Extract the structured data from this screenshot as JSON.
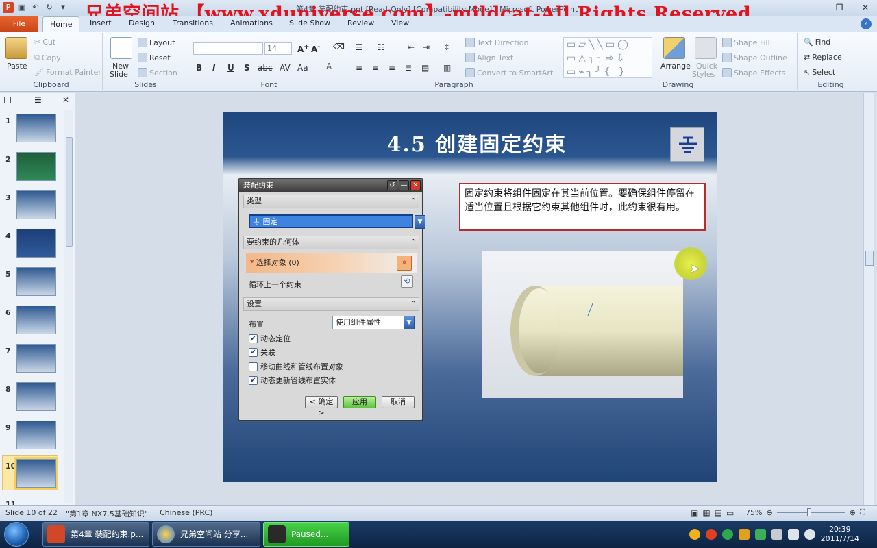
{
  "window": {
    "title": "第4章 装配约束.ppt [Read-Only] [Compatibility Mode] - Microsoft PowerPoint",
    "watermark": "兄弟空间站 【www.xduniverse.com】-mildcat-All Rights Reserved"
  },
  "tabs": {
    "file": "File",
    "items": [
      "Home",
      "Insert",
      "Design",
      "Transitions",
      "Animations",
      "Slide Show",
      "Review",
      "View"
    ]
  },
  "ribbon": {
    "clipboard": {
      "label": "Clipboard",
      "paste": "Paste",
      "cut": "Cut",
      "copy": "Copy",
      "format_painter": "Format Painter"
    },
    "slides": {
      "label": "Slides",
      "new_slide": "New",
      "new_slide2": "Slide",
      "layout": "Layout",
      "reset": "Reset",
      "section": "Section"
    },
    "font": {
      "label": "Font",
      "size": "14"
    },
    "paragraph": {
      "label": "Paragraph",
      "text_direction": "Text Direction",
      "align_text": "Align Text",
      "smartart": "Convert to SmartArt"
    },
    "drawing": {
      "label": "Drawing",
      "arrange": "Arrange",
      "quick_styles": "Quick",
      "quick_styles2": "Styles",
      "shape_fill": "Shape Fill",
      "shape_outline": "Shape Outline",
      "shape_effects": "Shape Effects"
    },
    "editing": {
      "label": "Editing",
      "find": "Find",
      "replace": "Replace",
      "select": "Select"
    }
  },
  "thumbnails": [
    "1",
    "2",
    "3",
    "4",
    "5",
    "6",
    "7",
    "8",
    "9",
    "10",
    "11"
  ],
  "slide": {
    "title": "4.5 创建固定约束",
    "textbox": "固定约束将组件固定在其当前位置。要确保组件停留在适当位置且根据它约束其他组件时，此约束很有用。"
  },
  "dialog": {
    "title": "装配约束",
    "type_section": "类型",
    "type_value": "固定",
    "geometry_section": "要约束的几何体",
    "select_object": "选择对象 (0)",
    "cycle_last": "循环上一个约束",
    "settings_section": "设置",
    "layout_label": "布置",
    "layout_value": "使用组件属性",
    "checkboxes": [
      {
        "label": "动态定位",
        "checked": true
      },
      {
        "label": "关联",
        "checked": true
      },
      {
        "label": "移动曲线和管线布置对象",
        "checked": false
      },
      {
        "label": "动态更新管线布置实体",
        "checked": true
      }
    ],
    "ok": "< 确定 >",
    "apply": "应用",
    "cancel": "取消"
  },
  "status": {
    "slide_info": "Slide 10 of 22",
    "theme": "\"第1章 NX7.5基础知识\"",
    "language": "Chinese (PRC)",
    "zoom": "75%"
  },
  "taskbar": {
    "tasks": [
      "第4章 装配约束.p...",
      "兄弟空间站 分享...",
      "Paused..."
    ],
    "time": "20:39",
    "date": "2011/7/14"
  }
}
